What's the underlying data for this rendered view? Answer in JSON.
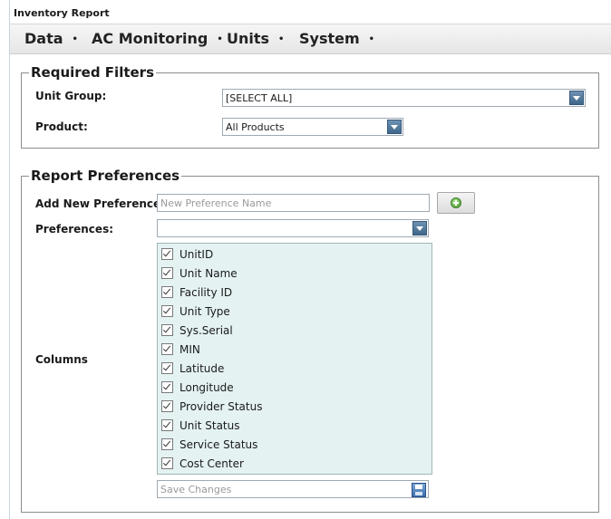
{
  "window": {
    "title": "Inventory Report"
  },
  "menu": {
    "items": [
      {
        "label": "Data"
      },
      {
        "label": "AC Monitoring"
      },
      {
        "label": "Units"
      },
      {
        "label": "System"
      }
    ],
    "caret": "•"
  },
  "required_filters": {
    "legend": "Required Filters",
    "unit_group_label": "Unit Group:",
    "unit_group_value": "[SELECT ALL]",
    "product_label": "Product:",
    "product_value": "All Products"
  },
  "report_preferences": {
    "legend": "Report Preferences",
    "add_new_label": "Add New Preference:",
    "add_new_placeholder": "New Preference Name",
    "preferences_label": "Preferences:",
    "preferences_value": "",
    "columns_label": "Columns",
    "columns": [
      {
        "label": "UnitID",
        "checked": true
      },
      {
        "label": "Unit Name",
        "checked": true
      },
      {
        "label": "Facility ID",
        "checked": true
      },
      {
        "label": "Unit Type",
        "checked": true
      },
      {
        "label": "Sys.Serial",
        "checked": true
      },
      {
        "label": "MIN",
        "checked": true
      },
      {
        "label": "Latitude",
        "checked": true
      },
      {
        "label": "Longitude",
        "checked": true
      },
      {
        "label": "Provider Status",
        "checked": true
      },
      {
        "label": "Unit Status",
        "checked": true
      },
      {
        "label": "Service Status",
        "checked": true
      },
      {
        "label": "Cost Center",
        "checked": true
      }
    ],
    "save_placeholder": "Save Changes"
  },
  "icons": {
    "add": "plus-circle-icon",
    "save": "floppy-disk-icon",
    "dropdown": "chevron-down-icon",
    "check": "check-icon"
  },
  "colors": {
    "dropdown_arrow": "#4a7397",
    "columns_bg": "#e4f2f2",
    "add_icon": "#4a9a2e"
  }
}
